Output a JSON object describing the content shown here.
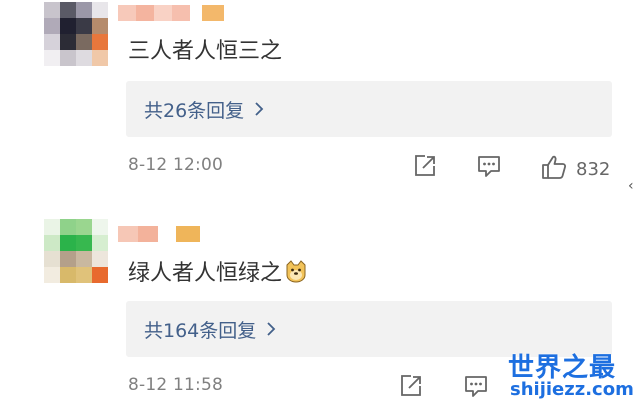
{
  "comments": [
    {
      "text": "三人者人恒三之",
      "replies_label": "共26条回复",
      "timestamp": "8-12 12:00",
      "likes": "832"
    },
    {
      "text": "绿人者人恒绿之",
      "replies_label": "共164条回复",
      "timestamp": "8-12 11:58",
      "emoji": "doge-emoji"
    }
  ],
  "icons": {
    "share": "share-icon",
    "reply": "comment-icon",
    "like": "thumbs-up-icon",
    "chevron": "chevron-right-icon"
  },
  "watermark": {
    "title": "世界之最",
    "url": "shijiezz.com"
  },
  "colors": {
    "link": "#43608a",
    "reply_bg": "#f2f2f2",
    "meta": "#808080",
    "watermark": "#1d6fe0"
  }
}
